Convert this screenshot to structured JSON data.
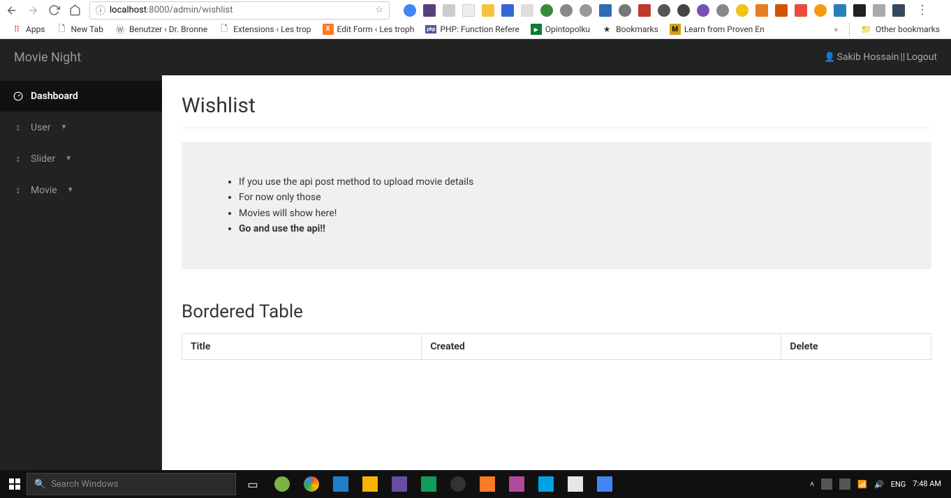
{
  "browser": {
    "url_host": "localhost",
    "url_rest": ":8000/admin/wishlist",
    "bookmarks": [
      {
        "label": "Apps",
        "icon": "apps"
      },
      {
        "label": "New Tab",
        "icon": "page"
      },
      {
        "label": "Benutzer ‹ Dr. Bronne",
        "icon": "wp"
      },
      {
        "label": "Extensions ‹ Les trop",
        "icon": "page"
      },
      {
        "label": "Edit Form ‹ Les troph",
        "icon": "xampp"
      },
      {
        "label": "PHP: Function Refere",
        "icon": "php"
      },
      {
        "label": "Opintopolku",
        "icon": "play"
      },
      {
        "label": "Bookmarks",
        "icon": "star"
      },
      {
        "label": "Learn from Proven En",
        "icon": "m"
      }
    ],
    "other_bookmarks": "Other bookmarks"
  },
  "header": {
    "brand": "Movie Night",
    "username": "Sakib Hossain",
    "sep": "||",
    "logout": "Logout"
  },
  "sidebar": {
    "items": [
      {
        "label": "Dashboard",
        "active": true,
        "icon": "dashboard",
        "expandable": false
      },
      {
        "label": "User",
        "active": false,
        "icon": "updown",
        "expandable": true
      },
      {
        "label": "Slider",
        "active": false,
        "icon": "updown",
        "expandable": true
      },
      {
        "label": "Movie",
        "active": false,
        "icon": "updown",
        "expandable": true
      }
    ]
  },
  "page": {
    "title": "Wishlist",
    "notes": [
      "If you use the api post method to upload movie details",
      "For now only those",
      "Movies will show here!",
      "Go and use the api!!"
    ],
    "section_title": "Bordered Table",
    "table": {
      "headers": [
        "Title",
        "Created",
        "Delete"
      ],
      "rows": []
    }
  },
  "taskbar": {
    "search_placeholder": "Search Windows",
    "lang": "ENG",
    "time": "7:48 AM"
  }
}
